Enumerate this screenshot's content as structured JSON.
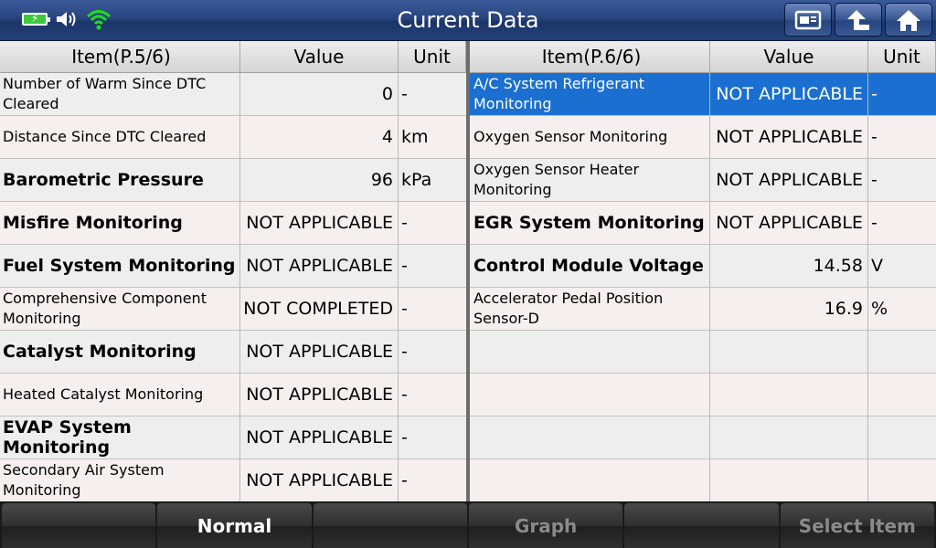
{
  "header": {
    "title": "Current Data",
    "status_icons": [
      "battery-charging-icon",
      "speaker-icon",
      "wifi-icon"
    ],
    "nav_icons": [
      "screenshot-icon",
      "back-arrow-icon",
      "home-icon"
    ]
  },
  "left_table": {
    "columns": [
      "Item(P.5/6)",
      "Value",
      "Unit"
    ],
    "rows": [
      {
        "item": "Number of Warm Since DTC Cleared",
        "value": "0",
        "unit": "-"
      },
      {
        "item": "Distance Since DTC Cleared",
        "value": "4",
        "unit": "km"
      },
      {
        "item": "Barometric Pressure",
        "value": "96",
        "unit": "kPa"
      },
      {
        "item": "Misfire Monitoring",
        "value": "NOT APPLICABLE",
        "unit": "-"
      },
      {
        "item": "Fuel System Monitoring",
        "value": "NOT APPLICABLE",
        "unit": "-"
      },
      {
        "item": "Comprehensive Component Monitoring",
        "value": "NOT COMPLETED",
        "unit": "-"
      },
      {
        "item": "Catalyst Monitoring",
        "value": "NOT APPLICABLE",
        "unit": "-"
      },
      {
        "item": "Heated Catalyst Monitoring",
        "value": "NOT APPLICABLE",
        "unit": "-"
      },
      {
        "item": "EVAP System Monitoring",
        "value": "NOT APPLICABLE",
        "unit": "-"
      },
      {
        "item": "Secondary Air System Monitoring",
        "value": "NOT APPLICABLE",
        "unit": "-"
      }
    ]
  },
  "right_table": {
    "columns": [
      "Item(P.6/6)",
      "Value",
      "Unit"
    ],
    "rows": [
      {
        "item": "A/C System Refrigerant Monitoring",
        "value": "NOT APPLICABLE",
        "unit": "-",
        "selected": true
      },
      {
        "item": "Oxygen Sensor Monitoring",
        "value": "NOT APPLICABLE",
        "unit": "-"
      },
      {
        "item": "Oxygen Sensor Heater Monitoring",
        "value": "NOT APPLICABLE",
        "unit": "-"
      },
      {
        "item": "EGR System Monitoring",
        "value": "NOT APPLICABLE",
        "unit": "-"
      },
      {
        "item": "Control Module Voltage",
        "value": "14.58",
        "unit": "V"
      },
      {
        "item": "Accelerator Pedal Position Sensor-D",
        "value": "16.9",
        "unit": "%"
      },
      {
        "item": "",
        "value": "",
        "unit": ""
      },
      {
        "item": "",
        "value": "",
        "unit": ""
      },
      {
        "item": "",
        "value": "",
        "unit": ""
      },
      {
        "item": "",
        "value": "",
        "unit": ""
      }
    ]
  },
  "bottom_bar": {
    "buttons": [
      {
        "label": "",
        "enabled": true
      },
      {
        "label": "Normal",
        "enabled": true
      },
      {
        "label": "",
        "enabled": true
      },
      {
        "label": "Graph",
        "enabled": false
      },
      {
        "label": "",
        "enabled": true
      },
      {
        "label": "Select Item",
        "enabled": false
      }
    ]
  },
  "colors": {
    "title_bar": "#28457f",
    "selection": "#1a6fd0",
    "battery": "#3ec83e",
    "wifi": "#22d822"
  }
}
